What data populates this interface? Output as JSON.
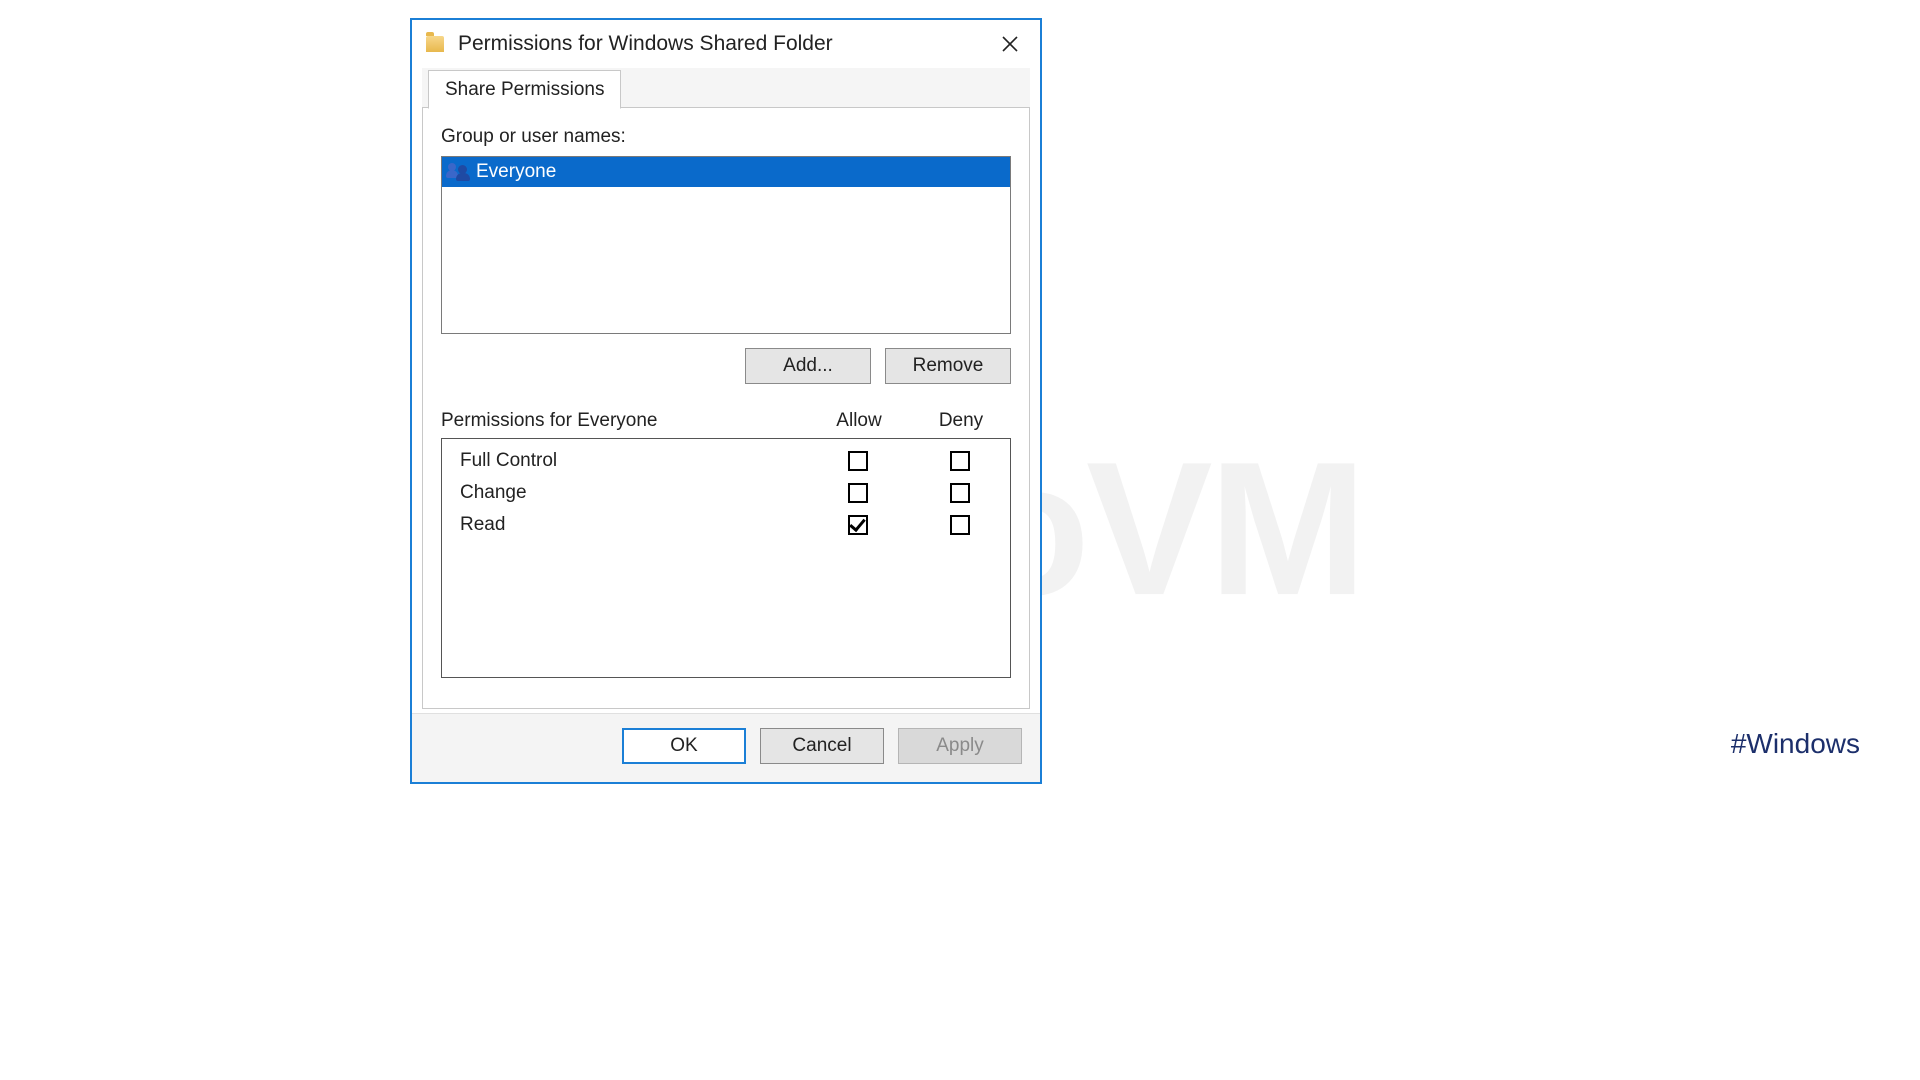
{
  "watermark": "NeuroVM",
  "hashtag": "#Windows",
  "dialog": {
    "title": "Permissions for Windows Shared Folder",
    "tab_label": "Share Permissions",
    "group_label": "Group or user names:",
    "users": [
      {
        "name": "Everyone",
        "selected": true
      }
    ],
    "add_label": "Add...",
    "remove_label": "Remove",
    "perm_for_label": "Permissions for Everyone",
    "col_allow": "Allow",
    "col_deny": "Deny",
    "permissions": [
      {
        "name": "Full Control",
        "allow": false,
        "deny": false
      },
      {
        "name": "Change",
        "allow": false,
        "deny": false
      },
      {
        "name": "Read",
        "allow": true,
        "deny": false
      }
    ],
    "ok_label": "OK",
    "cancel_label": "Cancel",
    "apply_label": "Apply"
  }
}
